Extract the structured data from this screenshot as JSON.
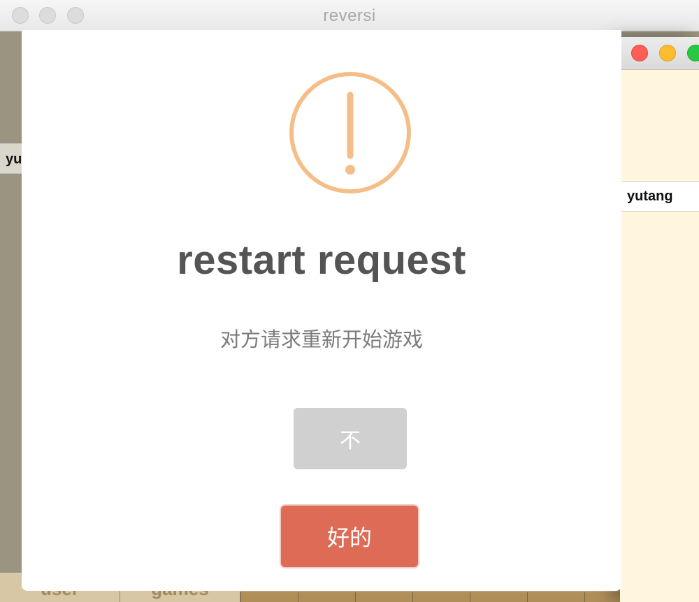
{
  "window": {
    "title": "reversi"
  },
  "left_panel": {
    "user_label": "yu"
  },
  "bottom_tabs": [
    "user",
    "games"
  ],
  "second_window": {
    "user_name": "yutang"
  },
  "dialog": {
    "icon": "warning-exclamation-icon",
    "title": "restart request",
    "text": "对方请求重新开始游戏",
    "cancel_label": "不",
    "confirm_label": "好的"
  },
  "colors": {
    "warning_icon": "#f5be88",
    "confirm_button": "#dd6b55",
    "cancel_button": "#d0d0d0",
    "second_window_bg": "#fff6dd"
  }
}
